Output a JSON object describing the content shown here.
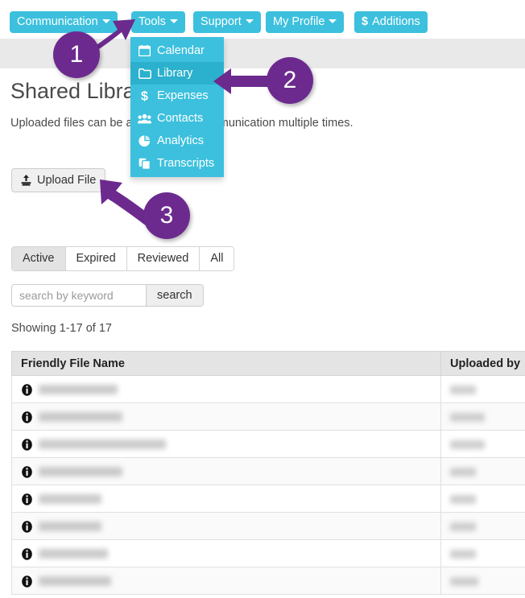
{
  "nav": {
    "items": [
      {
        "label": "Communication",
        "caret": true,
        "icon": null
      },
      {
        "label": "Tools",
        "caret": true,
        "icon": null
      },
      {
        "label": "Support",
        "caret": true,
        "icon": null
      },
      {
        "label": "My Profile",
        "caret": true,
        "icon": null
      },
      {
        "label": "Additions",
        "caret": false,
        "icon": "dollar-icon"
      }
    ],
    "button_color": "#3cc0dd"
  },
  "dropdown": {
    "open_for": "Tools",
    "highlight_color": "#2bb1cd",
    "items": [
      {
        "label": "Calendar",
        "icon": "calendar-icon",
        "active": false
      },
      {
        "label": "Library",
        "icon": "folder-icon",
        "active": true
      },
      {
        "label": "Expenses",
        "icon": "dollar-icon",
        "active": false
      },
      {
        "label": "Contacts",
        "icon": "users-icon",
        "active": false
      },
      {
        "label": "Analytics",
        "icon": "pie-chart-icon",
        "active": false
      },
      {
        "label": "Transcripts",
        "icon": "copy-icon",
        "active": false
      }
    ]
  },
  "page": {
    "title": "Shared Library",
    "description": "Uploaded files can be attached to a communication multiple times."
  },
  "toolbar": {
    "upload_label": "Upload File",
    "upload_icon": "upload-icon"
  },
  "tabs": [
    {
      "label": "Active",
      "selected": true
    },
    {
      "label": "Expired",
      "selected": false
    },
    {
      "label": "Reviewed",
      "selected": false
    },
    {
      "label": "All",
      "selected": false
    }
  ],
  "search": {
    "value": "",
    "placeholder": "search by keyword",
    "button_label": "search"
  },
  "results": {
    "showing": "Showing 1-17 of 17"
  },
  "table": {
    "columns": [
      {
        "key": "name",
        "label": "Friendly File Name"
      },
      {
        "key": "by",
        "label": "Uploaded by"
      }
    ],
    "rows": [
      {
        "name_redacted_width": 98,
        "by_redacted_width": 32
      },
      {
        "name_redacted_width": 104,
        "by_redacted_width": 43
      },
      {
        "name_redacted_width": 158,
        "by_redacted_width": 43
      },
      {
        "name_redacted_width": 104,
        "by_redacted_width": 32
      },
      {
        "name_redacted_width": 78,
        "by_redacted_width": 32
      },
      {
        "name_redacted_width": 78,
        "by_redacted_width": 32
      },
      {
        "name_redacted_width": 86,
        "by_redacted_width": 32
      },
      {
        "name_redacted_width": 90,
        "by_redacted_width": 35
      }
    ]
  },
  "callouts": [
    {
      "number": "1",
      "points_to": "tools-nav-button"
    },
    {
      "number": "2",
      "points_to": "dropdown-item-library"
    },
    {
      "number": "3",
      "points_to": "upload-file-button"
    }
  ],
  "colors": {
    "accent_teal": "#3cc0dd",
    "accent_teal_dark": "#2bb1cd",
    "callout_purple": "#6c2a8e",
    "band_gray": "#e9e9e9"
  }
}
